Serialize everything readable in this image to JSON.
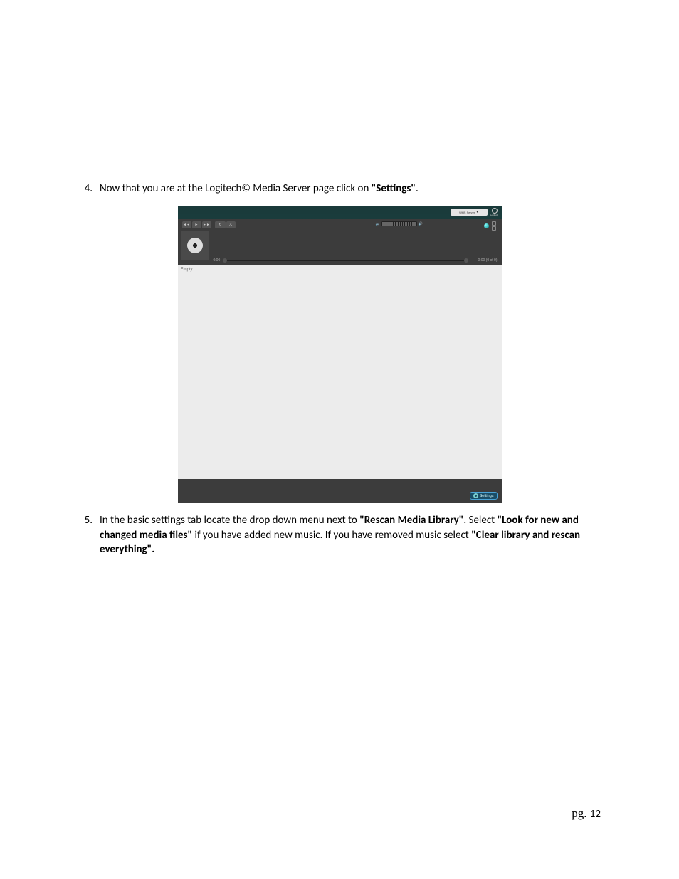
{
  "steps": {
    "item4": {
      "num": "4.",
      "text_before": "Now that you are at the Logitech© Media Server page click on ",
      "bold": "\"Settings\"",
      "text_after": "."
    },
    "item5": {
      "num": "5.",
      "part1": "In the basic settings tab locate the drop down menu next to ",
      "bold1": "\"Rescan Media Library\"",
      "part2": ". Select ",
      "bold2": "\"Look for new and changed media files\"",
      "part3": " if you have added new music. If you have removed music select ",
      "bold3": "\"Clear library and rescan everything\"."
    }
  },
  "screenshot": {
    "server_label": "WHS Server",
    "logo_text": "Logitech",
    "time_start": "0:00",
    "time_end": "0:00 (0 of 0)",
    "empty": "Empty",
    "settings_label": "Settings"
  },
  "footer": {
    "prefix": "pg. ",
    "page_number": "12"
  }
}
